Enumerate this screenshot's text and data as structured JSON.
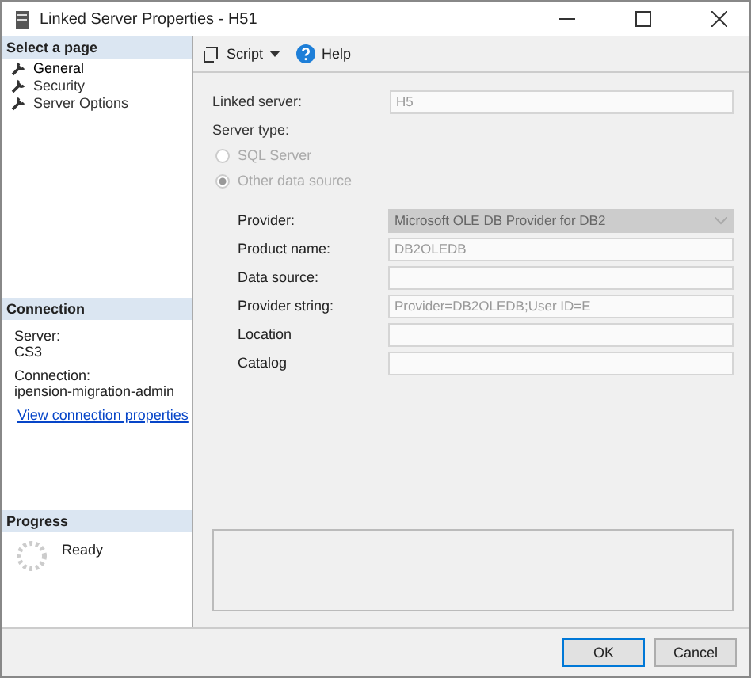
{
  "window": {
    "title": "Linked Server Properties - H51"
  },
  "select_page": {
    "header": "Select a page",
    "items": [
      {
        "label": "General",
        "selected": true
      },
      {
        "label": "Security",
        "selected": false
      },
      {
        "label": "Server Options",
        "selected": false
      }
    ]
  },
  "connection": {
    "header": "Connection",
    "server_label": "Server:",
    "server": "CS3",
    "connection_label": "Connection:",
    "connection": "ipension-migration-admin",
    "link": "View connection properties"
  },
  "progress": {
    "header": "Progress",
    "status": "Ready"
  },
  "toolbar": {
    "script": "Script",
    "help": "Help"
  },
  "linked_server": {
    "label": "Linked server:",
    "value": "H5"
  },
  "server_type": {
    "label": "Server type:",
    "options": [
      {
        "label": "SQL Server",
        "selected": false,
        "disabled": true
      },
      {
        "label": "Other data source",
        "selected": true,
        "disabled": true
      }
    ]
  },
  "fields": [
    {
      "label": "Provider:",
      "value": "Microsoft OLE DB Provider for DB2",
      "kind": "dropdown",
      "disabled": true
    },
    {
      "label": "Product name:",
      "value": "DB2OLEDB",
      "kind": "text",
      "disabled": false
    },
    {
      "label": "Data source:",
      "kind": "text",
      "disabled": false
    },
    {
      "label": "Provider string:",
      "value": "Provider=DB2OLEDB;User ID=E",
      "kind": "text",
      "disabled": false
    },
    {
      "label": "Location",
      "kind": "text",
      "disabled": false
    },
    {
      "label": "Catalog",
      "kind": "text",
      "disabled": false
    }
  ],
  "buttons": [
    {
      "label": "OK",
      "default": true
    },
    {
      "label": "Cancel",
      "default": false
    }
  ]
}
